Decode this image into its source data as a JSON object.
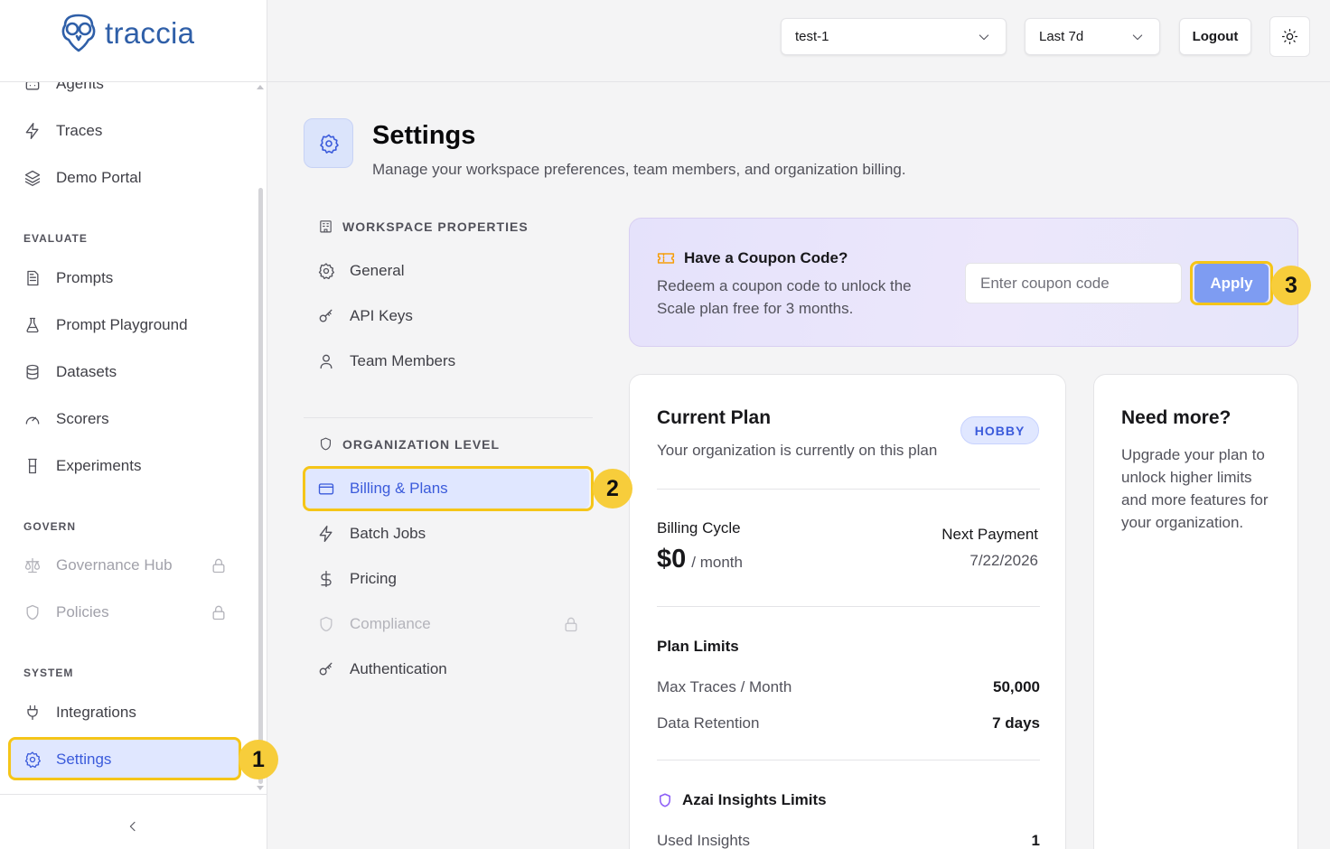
{
  "app": {
    "brand": "traccia"
  },
  "sidebar": {
    "items_top": [
      {
        "label": "Agents",
        "icon": "agents-icon"
      },
      {
        "label": "Traces",
        "icon": "bolt-icon"
      },
      {
        "label": "Demo Portal",
        "icon": "layers-icon"
      }
    ],
    "sections": {
      "evaluate": "EVALUATE",
      "govern": "GOVERN",
      "system": "SYSTEM"
    },
    "evaluate_items": [
      {
        "label": "Prompts",
        "icon": "document-icon"
      },
      {
        "label": "Prompt Playground",
        "icon": "flask-icon"
      },
      {
        "label": "Datasets",
        "icon": "database-icon"
      },
      {
        "label": "Scorers",
        "icon": "gauge-icon"
      },
      {
        "label": "Experiments",
        "icon": "beaker-icon"
      }
    ],
    "govern_items": [
      {
        "label": "Governance Hub",
        "icon": "scale-icon",
        "locked": true
      },
      {
        "label": "Policies",
        "icon": "shield-icon",
        "locked": true
      }
    ],
    "system_items": [
      {
        "label": "Integrations",
        "icon": "plug-icon"
      },
      {
        "label": "Settings",
        "icon": "gear-icon",
        "active": true
      }
    ]
  },
  "topbar": {
    "project_select": "test-1",
    "range_select": "Last 7d",
    "logout_label": "Logout"
  },
  "header": {
    "title": "Settings",
    "subtitle": "Manage your workspace preferences, team members, and organization billing."
  },
  "settings_nav": {
    "workspace_heading": "WORKSPACE PROPERTIES",
    "workspace_items": [
      "General",
      "API Keys",
      "Team Members"
    ],
    "org_heading": "ORGANIZATION LEVEL",
    "org_items": [
      "Billing & Plans",
      "Batch Jobs",
      "Pricing",
      "Compliance",
      "Authentication"
    ]
  },
  "coupon": {
    "title": "Have a Coupon Code?",
    "description": "Redeem a coupon code to unlock the Scale plan free for 3 months.",
    "placeholder": "Enter coupon code",
    "apply_label": "Apply"
  },
  "plan": {
    "title": "Current Plan",
    "subtitle": "Your organization is currently on this plan",
    "badge": "HOBBY",
    "billing_label": "Billing Cycle",
    "price": "$0",
    "period": "/ month",
    "next_label": "Next Payment",
    "next_date": "7/22/2026",
    "limits_title": "Plan Limits",
    "limits": [
      {
        "label": "Max Traces / Month",
        "value": "50,000"
      },
      {
        "label": "Data Retention",
        "value": "7 days"
      }
    ],
    "insights_title": "Azai Insights Limits",
    "insights": [
      {
        "label": "Used Insights",
        "value": "1"
      }
    ]
  },
  "more": {
    "title": "Need more?",
    "description": "Upgrade your plan to unlock higher limits and more features for your organization."
  },
  "callouts": [
    "1",
    "2",
    "3"
  ],
  "colors": {
    "accent": "#3b5bdb",
    "highlight": "#f5c518",
    "apply_button": "#7e9cf2"
  }
}
